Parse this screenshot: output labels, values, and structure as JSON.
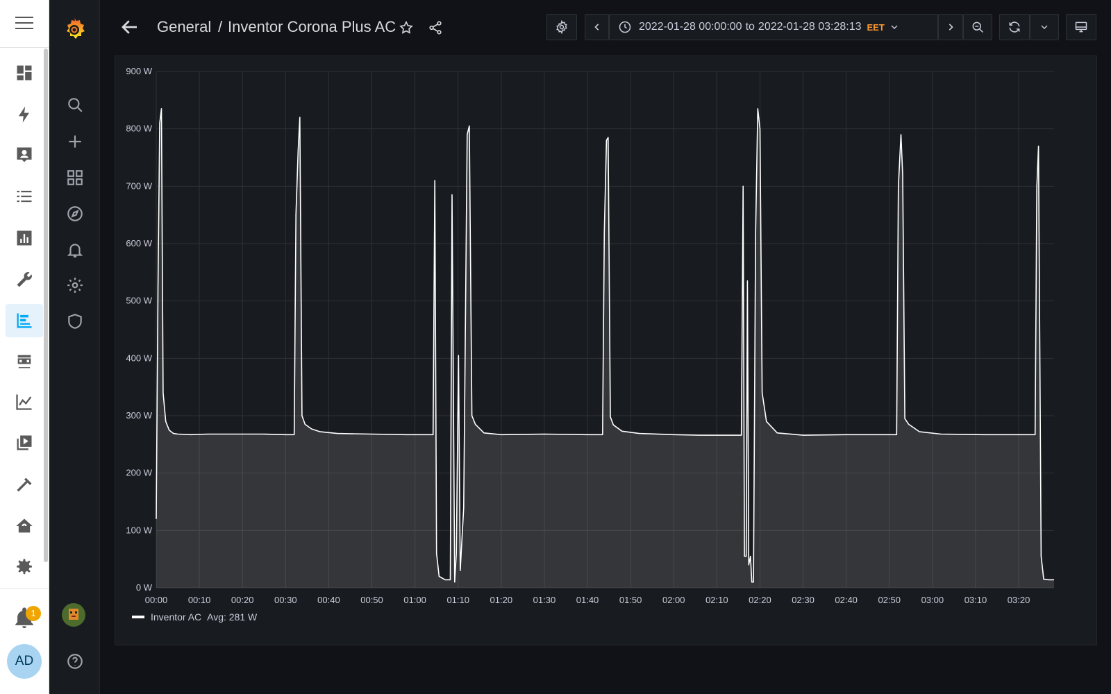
{
  "breadcrumb": {
    "folder": "General",
    "separator": "/",
    "dashboard": "Inventor Corona Plus AC"
  },
  "time_range": {
    "from": "2022-01-28 00:00:00",
    "to_word": "to",
    "to": "2022-01-28 03:28:13",
    "timezone": "EET"
  },
  "ha_sidebar": {
    "items": [
      "overview-icon",
      "energy-icon",
      "logbook-icon",
      "todo-list-icon",
      "history-icon",
      "tools-icon",
      "grafana-icon",
      "hacs-icon",
      "chart-icon",
      "media-icon",
      "hammer-icon",
      "home-sensor-icon",
      "settings-icon"
    ],
    "active_item": "grafana-icon",
    "notification_count": "1",
    "user_initials": "AD"
  },
  "grafana_menu": [
    "search-icon",
    "plus-icon",
    "dashboards-icon",
    "explore-icon",
    "alerting-icon",
    "configuration-icon",
    "server-admin-icon",
    "help-icon"
  ],
  "colors": {
    "series": "#ffffff",
    "accent": "#ff7000",
    "timezone": "#ff9830",
    "ha_active": "#03a9f4",
    "badge": "#f0a500"
  },
  "chart_data": {
    "type": "line",
    "series": [
      {
        "name": "Inventor AC",
        "points": [
          [
            0,
            120
          ],
          [
            0.4,
            520
          ],
          [
            0.8,
            810
          ],
          [
            1.2,
            835
          ],
          [
            1.6,
            340
          ],
          [
            2.2,
            290
          ],
          [
            3,
            275
          ],
          [
            4,
            269
          ],
          [
            5,
            268
          ],
          [
            8,
            267
          ],
          [
            12,
            268
          ],
          [
            16,
            268
          ],
          [
            20,
            268
          ],
          [
            25,
            268
          ],
          [
            30,
            267
          ],
          [
            32,
            267
          ],
          [
            32.4,
            650
          ],
          [
            32.9,
            760
          ],
          [
            33.3,
            820
          ],
          [
            33.8,
            300
          ],
          [
            34.5,
            285
          ],
          [
            36,
            277
          ],
          [
            38,
            272
          ],
          [
            42,
            269
          ],
          [
            50,
            268
          ],
          [
            58,
            267
          ],
          [
            64.2,
            267
          ],
          [
            64.6,
            710
          ],
          [
            65,
            60
          ],
          [
            65.6,
            20
          ],
          [
            67,
            14
          ],
          [
            68,
            14
          ],
          [
            68.2,
            14
          ],
          [
            68.6,
            685
          ],
          [
            69.2,
            10
          ],
          [
            69.6,
            60
          ],
          [
            70.1,
            405
          ],
          [
            70.5,
            30
          ],
          [
            71.3,
            140
          ],
          [
            72.1,
            790
          ],
          [
            72.6,
            805
          ],
          [
            73.2,
            300
          ],
          [
            74,
            285
          ],
          [
            76,
            270
          ],
          [
            80,
            267
          ],
          [
            90,
            268
          ],
          [
            100,
            267
          ],
          [
            103.5,
            267
          ],
          [
            103.9,
            620
          ],
          [
            104.4,
            780
          ],
          [
            104.8,
            785
          ],
          [
            105.3,
            298
          ],
          [
            106,
            284
          ],
          [
            108,
            273
          ],
          [
            112,
            269
          ],
          [
            120,
            267
          ],
          [
            126,
            266
          ],
          [
            135,
            266
          ],
          [
            135.7,
            266
          ],
          [
            136.1,
            700
          ],
          [
            136.4,
            55
          ],
          [
            136.8,
            55
          ],
          [
            137.1,
            535
          ],
          [
            137.4,
            40
          ],
          [
            137.8,
            55
          ],
          [
            138.1,
            10
          ],
          [
            138.5,
            10
          ],
          [
            139,
            620
          ],
          [
            139.5,
            835
          ],
          [
            140,
            800
          ],
          [
            140.5,
            340
          ],
          [
            141.5,
            290
          ],
          [
            144,
            270
          ],
          [
            150,
            266
          ],
          [
            160,
            267
          ],
          [
            170,
            267
          ],
          [
            171.7,
            267
          ],
          [
            172.1,
            700
          ],
          [
            172.7,
            790
          ],
          [
            173.1,
            720
          ],
          [
            173.6,
            295
          ],
          [
            174.5,
            285
          ],
          [
            177,
            272
          ],
          [
            182,
            268
          ],
          [
            192,
            267
          ],
          [
            203.8,
            267
          ],
          [
            204.2,
            700
          ],
          [
            204.6,
            770
          ],
          [
            205.2,
            55
          ],
          [
            205.8,
            15
          ],
          [
            207,
            14
          ],
          [
            208.2,
            14
          ]
        ]
      }
    ],
    "x_ticks": [
      "00:00",
      "00:10",
      "00:20",
      "00:30",
      "00:40",
      "00:50",
      "01:00",
      "01:10",
      "01:20",
      "01:30",
      "01:40",
      "01:50",
      "02:00",
      "02:10",
      "02:20",
      "02:30",
      "02:40",
      "02:50",
      "03:00",
      "03:10",
      "03:20"
    ],
    "x_unit": "minutes",
    "x_range": [
      0,
      208.2
    ],
    "y_ticks": [
      "0 W",
      "100 W",
      "200 W",
      "300 W",
      "400 W",
      "500 W",
      "600 W",
      "700 W",
      "800 W",
      "900 W"
    ],
    "ylim": [
      0,
      900
    ],
    "grid": true,
    "fill": true,
    "legend": {
      "placement": "bottom-left",
      "label": "Inventor AC",
      "stat": "Avg: 281 W"
    }
  }
}
